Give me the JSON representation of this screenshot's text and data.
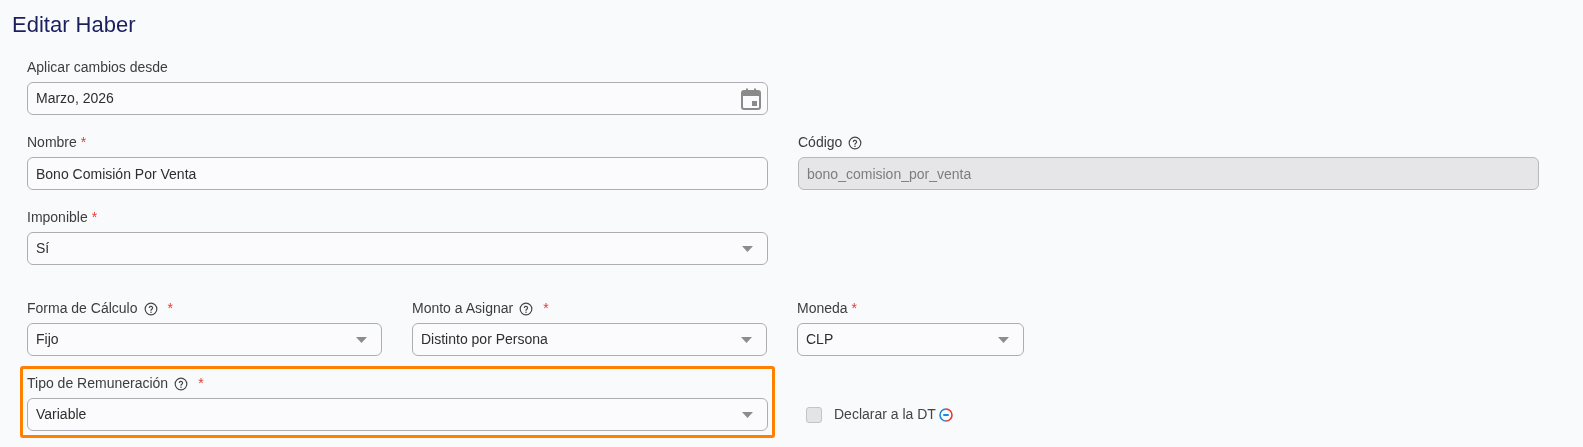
{
  "title": "Editar Haber",
  "rows": [
    [
      {
        "kind": "date",
        "label": "Aplicar cambios desde",
        "value": "Marzo, 2026",
        "help": false,
        "disabled": false,
        "highlighted": false
      }
    ],
    [
      {
        "kind": "text",
        "label": "Nombre",
        "required_mark": "*",
        "value": "Bono Comisión Por Venta",
        "help": false,
        "disabled": false,
        "highlighted": false
      },
      {
        "kind": "text",
        "label": "Código",
        "value": "bono_comision_por_venta",
        "help": true,
        "disabled": true,
        "highlighted": false
      }
    ],
    [
      {
        "kind": "select",
        "label": "Imponible",
        "required_mark": "*",
        "value": "Sí",
        "help": false,
        "disabled": false,
        "highlighted": false
      }
    ],
    [
      {
        "kind": "select",
        "label": "Forma de Cálculo",
        "required_mark": "*",
        "value": "Fijo",
        "help": true,
        "disabled": false,
        "highlighted": false
      },
      {
        "kind": "select",
        "label": "Monto a Asignar",
        "required_mark": "*",
        "value": "Distinto por Persona",
        "help": true,
        "disabled": false,
        "highlighted": false
      },
      {
        "kind": "select",
        "label": "Moneda",
        "required_mark": "*",
        "value": "CLP",
        "help": false,
        "disabled": false,
        "highlighted": false
      }
    ],
    [
      {
        "kind": "select",
        "label": "Tipo de Remuneración",
        "required_mark": "*",
        "value": "Variable",
        "help": true,
        "disabled": false,
        "highlighted": true
      },
      {
        "kind": "checkbox",
        "label": "Declarar a la DT",
        "checked": false,
        "badge": true
      }
    ]
  ]
}
